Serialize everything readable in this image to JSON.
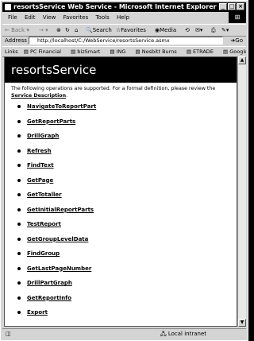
{
  "window": {
    "title": "resortsService Web Service - Microsoft Internet Explorer"
  },
  "menu": [
    "File",
    "Edit",
    "View",
    "Favorites",
    "Tools",
    "Help"
  ],
  "toolbar": {
    "back": "Back",
    "search": "Search",
    "favorites": "Favorites",
    "media": "Media"
  },
  "address": {
    "label": "Address",
    "url": "http://localhost/C:/WebService/resortsService.asmx",
    "go": "Go"
  },
  "links_bar": {
    "label": "Links",
    "items": [
      "PC Financial",
      "bizSmart",
      "ING",
      "Nesbitt Burns",
      "ETRADE",
      "Google"
    ]
  },
  "page": {
    "heading": "resortsService",
    "intro": "The following operations are supported. For a formal definition, please review the",
    "intro_link": "Service Description",
    "operations": [
      "NavigateToReportPart",
      "GetReportParts",
      "DrillGraph",
      "Refresh",
      "FindText",
      "GetPage",
      "GetTotaller",
      "GetInitialReportParts",
      "TestReport",
      "GetGroupLevelData",
      "FindGroup",
      "GetLastPageNumber",
      "DrillPartGraph",
      "GetReportInfo",
      "Export"
    ]
  },
  "statusbar": {
    "zone": "Local intranet"
  }
}
